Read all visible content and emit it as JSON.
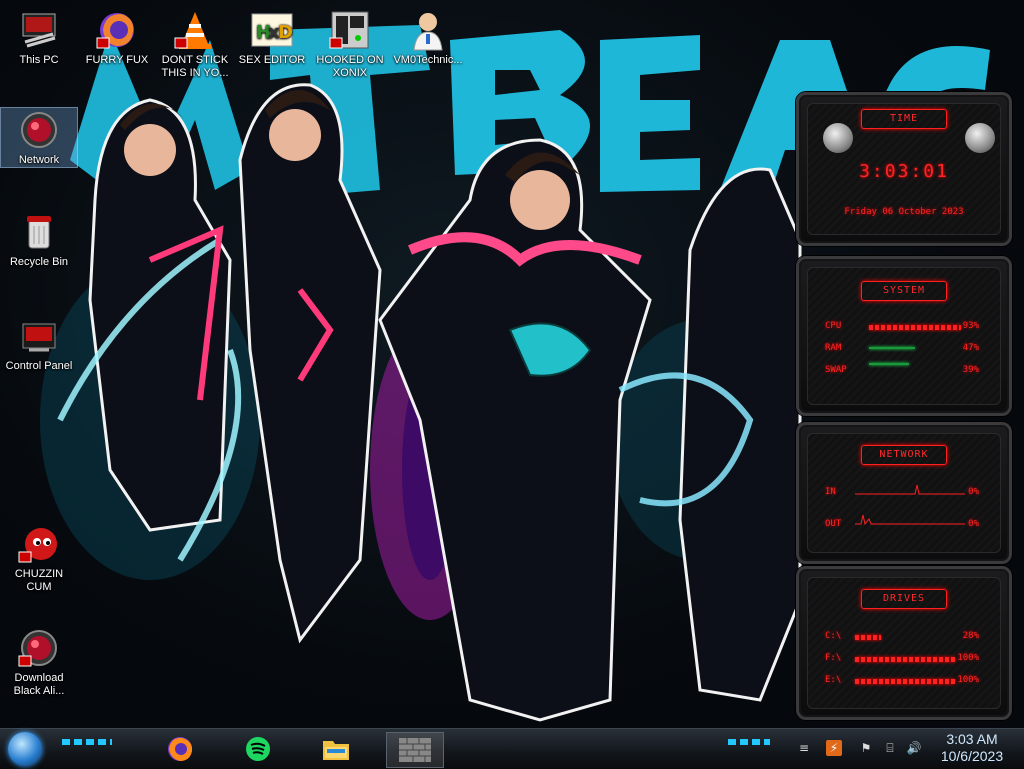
{
  "desktop_icons": [
    {
      "name": "this-pc",
      "label": "This PC"
    },
    {
      "name": "furry-fux",
      "label": "FURRY FUX"
    },
    {
      "name": "dont-stick",
      "label": "DONT STICK THIS IN YO..."
    },
    {
      "name": "sex-editor",
      "label": "SEX EDITOR"
    },
    {
      "name": "hooked-on-xonix",
      "label": "HOOKED ON XONIX"
    },
    {
      "name": "vm0technic",
      "label": "VM0Technic..."
    },
    {
      "name": "network",
      "label": "Network"
    },
    {
      "name": "recycle-bin",
      "label": "Recycle Bin"
    },
    {
      "name": "control-panel",
      "label": "Control Panel"
    },
    {
      "name": "chuzzin-cum",
      "label": "CHUZZIN CUM"
    },
    {
      "name": "download-black-ali",
      "label": "Download Black Ali..."
    }
  ],
  "widgets": {
    "time": {
      "title": "TIME",
      "clock": "3:03:01",
      "date": "Friday 06 October 2023"
    },
    "system": {
      "title": "SYSTEM",
      "rows": [
        {
          "label": "CPU",
          "value": "93%",
          "level": 0.93
        },
        {
          "label": "RAM",
          "value": "47%",
          "level": 0.47
        },
        {
          "label": "SWAP",
          "value": "39%",
          "level": 0.39
        }
      ]
    },
    "network": {
      "title": "NETWORK",
      "rows": [
        {
          "label": "IN",
          "value": "0%"
        },
        {
          "label": "OUT",
          "value": "0%"
        }
      ]
    },
    "drives": {
      "title": "DRIVES",
      "rows": [
        {
          "label": "C:\\",
          "value": "28%",
          "level": 0.28
        },
        {
          "label": "F:\\",
          "value": "100%",
          "level": 1.0
        },
        {
          "label": "E:\\",
          "value": "100%",
          "level": 1.0
        }
      ]
    }
  },
  "taskbar": {
    "apps": [
      "firefox-icon",
      "spotify-icon",
      "file-explorer-icon",
      "wall-app-icon"
    ],
    "clock_time": "3:03 AM",
    "clock_date": "10/6/2023"
  },
  "colors": {
    "accent_red": "#ff2020",
    "wallpaper_cyan": "#1fb7d8",
    "wallpaper_pink": "#ff3aa0"
  }
}
